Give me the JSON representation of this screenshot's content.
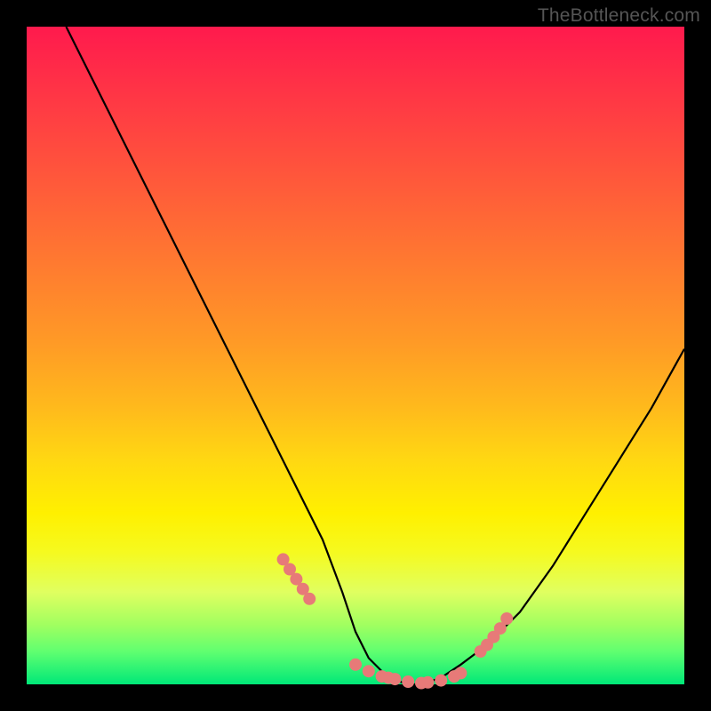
{
  "watermark": "TheBottleneck.com",
  "chart_data": {
    "type": "line",
    "title": "",
    "xlabel": "",
    "ylabel": "",
    "xlim": [
      0,
      100
    ],
    "ylim": [
      0,
      100
    ],
    "series": [
      {
        "name": "bottleneck-curve",
        "x": [
          6,
          10,
          15,
          20,
          25,
          30,
          35,
          40,
          45,
          48,
          50,
          52,
          55,
          58,
          60,
          63,
          66,
          70,
          75,
          80,
          85,
          90,
          95,
          100
        ],
        "values": [
          100,
          92,
          82,
          72,
          62,
          52,
          42,
          32,
          22,
          14,
          8,
          4,
          1,
          0,
          0,
          1,
          3,
          6,
          11,
          18,
          26,
          34,
          42,
          51
        ]
      }
    ],
    "markers": {
      "name": "highlight-dots",
      "color": "#e77a78",
      "x": [
        39,
        40,
        41,
        42,
        43,
        50,
        52,
        54,
        55,
        56,
        58,
        60,
        61,
        63,
        65,
        66,
        69,
        70,
        71,
        72,
        73
      ],
      "values": [
        19,
        17.5,
        16,
        14.5,
        13,
        3,
        2,
        1.2,
        1,
        0.8,
        0.4,
        0.2,
        0.3,
        0.6,
        1.2,
        1.7,
        5,
        6,
        7.2,
        8.5,
        10
      ]
    },
    "background_gradient": {
      "top": "#ff1a4d",
      "mid": "#fff000",
      "bottom": "#00e878"
    }
  }
}
